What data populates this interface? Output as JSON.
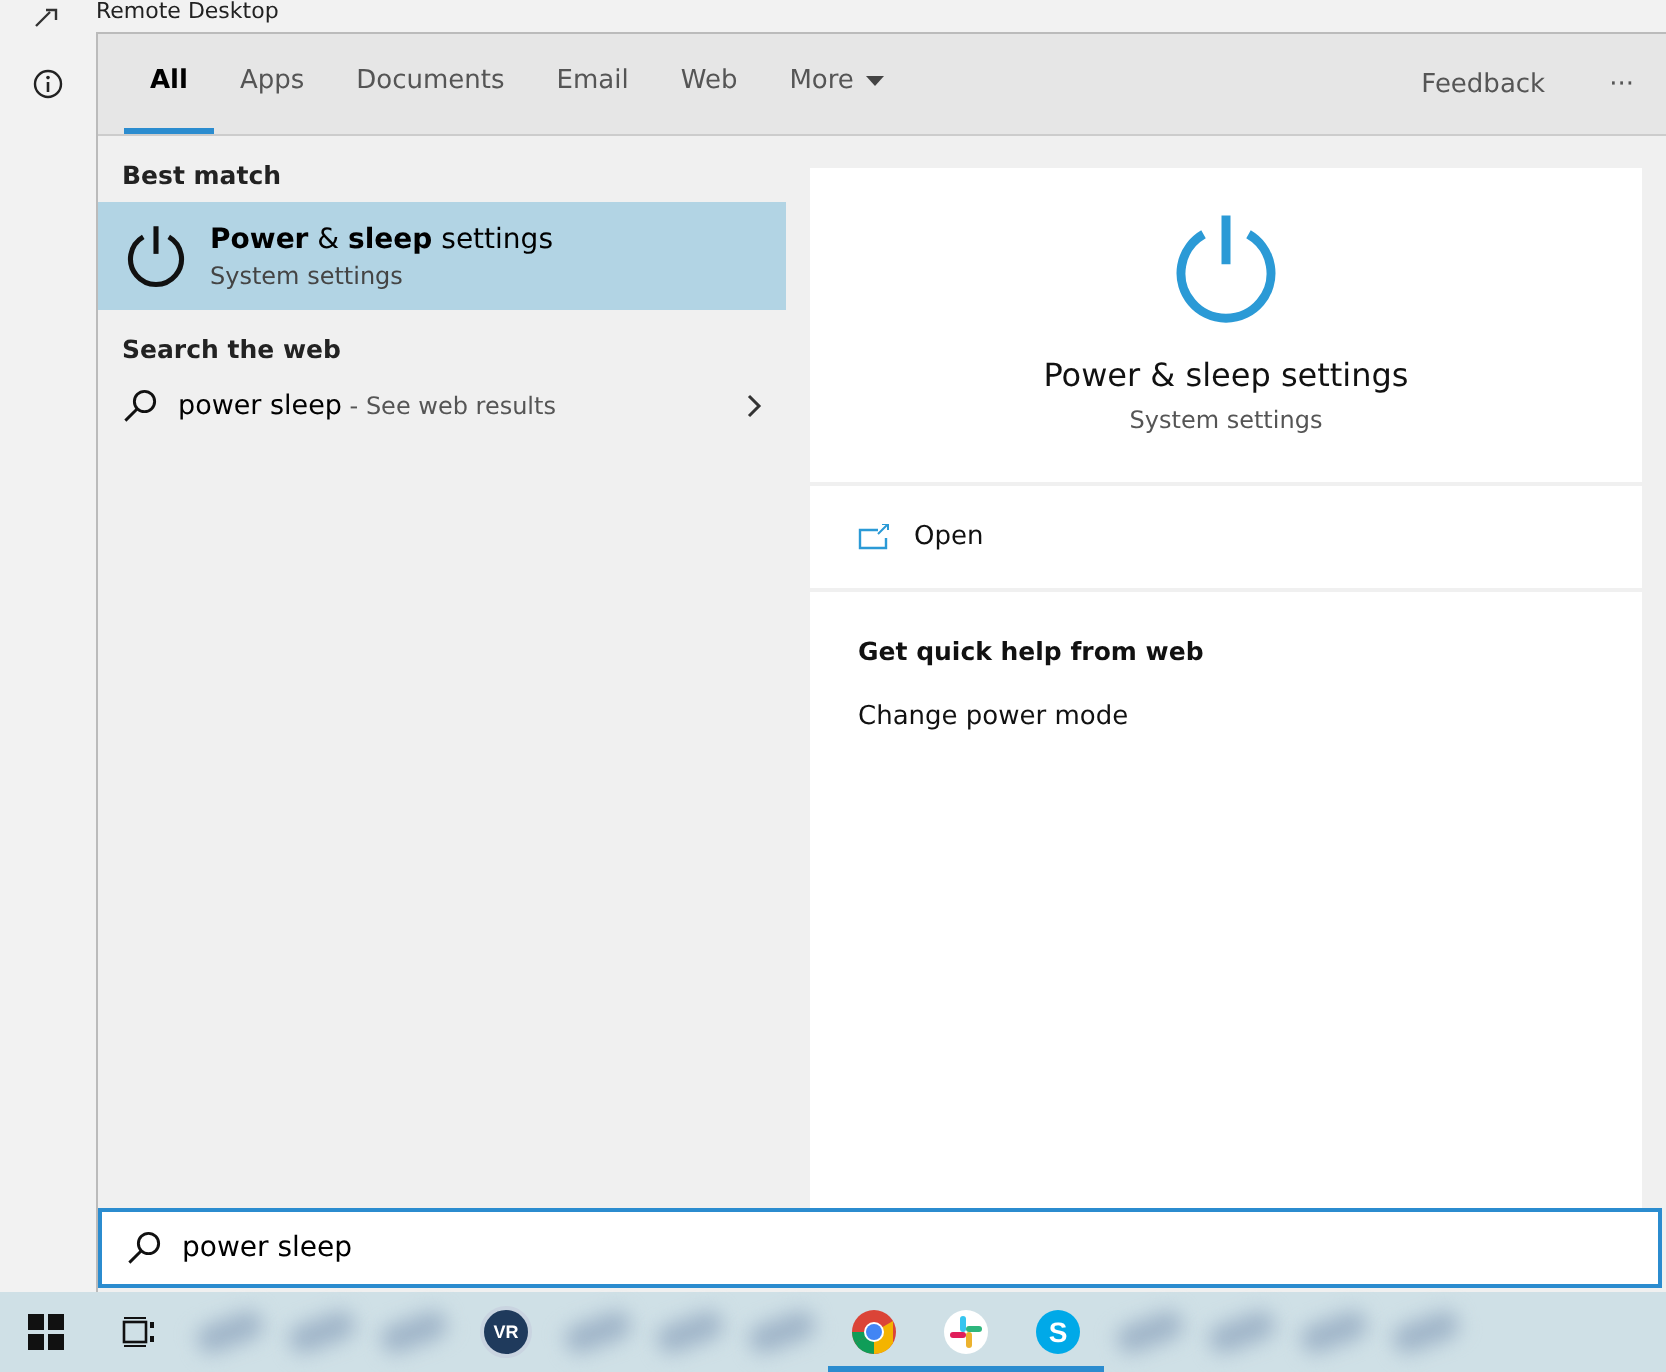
{
  "background_window": {
    "title": "Remote Desktop"
  },
  "tabs": [
    {
      "label": "All",
      "selected": true
    },
    {
      "label": "Apps",
      "selected": false
    },
    {
      "label": "Documents",
      "selected": false
    },
    {
      "label": "Email",
      "selected": false
    },
    {
      "label": "Web",
      "selected": false
    },
    {
      "label": "More",
      "selected": false,
      "dropdown": true
    }
  ],
  "header_actions": {
    "feedback": "Feedback",
    "more": "···"
  },
  "results": [
    {
      "heading": "Best match",
      "items": [
        {
          "kind": "app",
          "title": "**Power** & **sleep** settings",
          "subtitle": "System settings",
          "selected": true
        }
      ]
    },
    {
      "heading": "Search the web",
      "items": [
        {
          "kind": "web",
          "title": "power sleep",
          "suffix": " - See web results",
          "selected": false
        }
      ]
    }
  ],
  "preview": {
    "title": "Power & sleep settings",
    "subtitle": "System settings",
    "actions": [
      {
        "label": "Open"
      }
    ],
    "help_heading": "Get quick help from web",
    "help_links": [
      "Change power mode"
    ]
  },
  "search": {
    "value": "power sleep"
  },
  "taskbar": [
    {
      "kind": "start",
      "running": false
    },
    {
      "kind": "taskview",
      "running": false
    },
    {
      "kind": "blurred"
    },
    {
      "kind": "blurred"
    },
    {
      "kind": "blurred"
    },
    {
      "kind": "vr",
      "label": "VR",
      "running": false
    },
    {
      "kind": "blurred"
    },
    {
      "kind": "blurred"
    },
    {
      "kind": "blurred"
    },
    {
      "kind": "chrome",
      "running": true
    },
    {
      "kind": "slack",
      "running": true
    },
    {
      "kind": "skype",
      "running": true,
      "label": "S"
    },
    {
      "kind": "blurred"
    },
    {
      "kind": "blurred"
    },
    {
      "kind": "blurred"
    },
    {
      "kind": "blurred"
    }
  ]
}
